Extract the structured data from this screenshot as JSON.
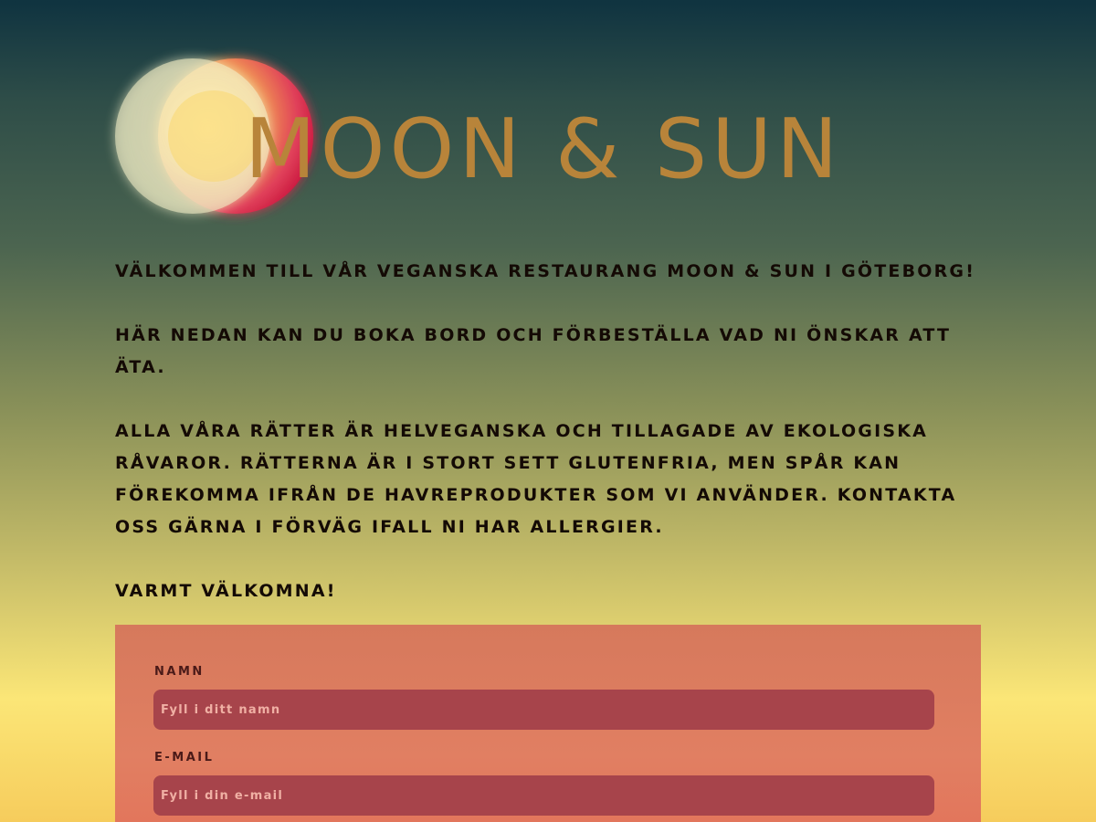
{
  "header": {
    "brand_title": "MOON & SUN",
    "logo_icon": "moon-and-sun-icon"
  },
  "intro": {
    "paragraphs": [
      "VÄLKOMMEN TILL VÅR VEGANSKA RESTAURANG MOON & SUN I GÖTEBORG!",
      "HÄR NEDAN KAN DU BOKA BORD OCH FÖRBESTÄLLA VAD NI ÖNSKAR ATT ÄTA.",
      "ALLA VÅRA RÄTTER ÄR HELVEGANSKA OCH TILLAGADE AV EKOLOGISKA RÅVAROR. RÄTTERNA ÄR I STORT SETT GLUTENFRIA, MEN SPÅR KAN FÖREKOMMA IFRÅN DE HAVREPRODUKTER SOM VI ANVÄNDER. KONTAKTA OSS GÄRNA I FÖRVÄG IFALL NI HAR ALLERGIER.",
      "VARMT VÄLKOMNA!"
    ]
  },
  "booking_form": {
    "name_label": "NAMN",
    "name_value": "",
    "name_placeholder": "Fyll i ditt namn",
    "email_label": "E-MAIL",
    "email_value": "",
    "email_placeholder": "Fyll i din e-mail"
  },
  "colors": {
    "brand_gold": "#b8843a",
    "form_background": "#e17f62",
    "input_background": "#a7444b",
    "sun_red": "#c8143c",
    "moon_pale": "#fff3b0"
  }
}
